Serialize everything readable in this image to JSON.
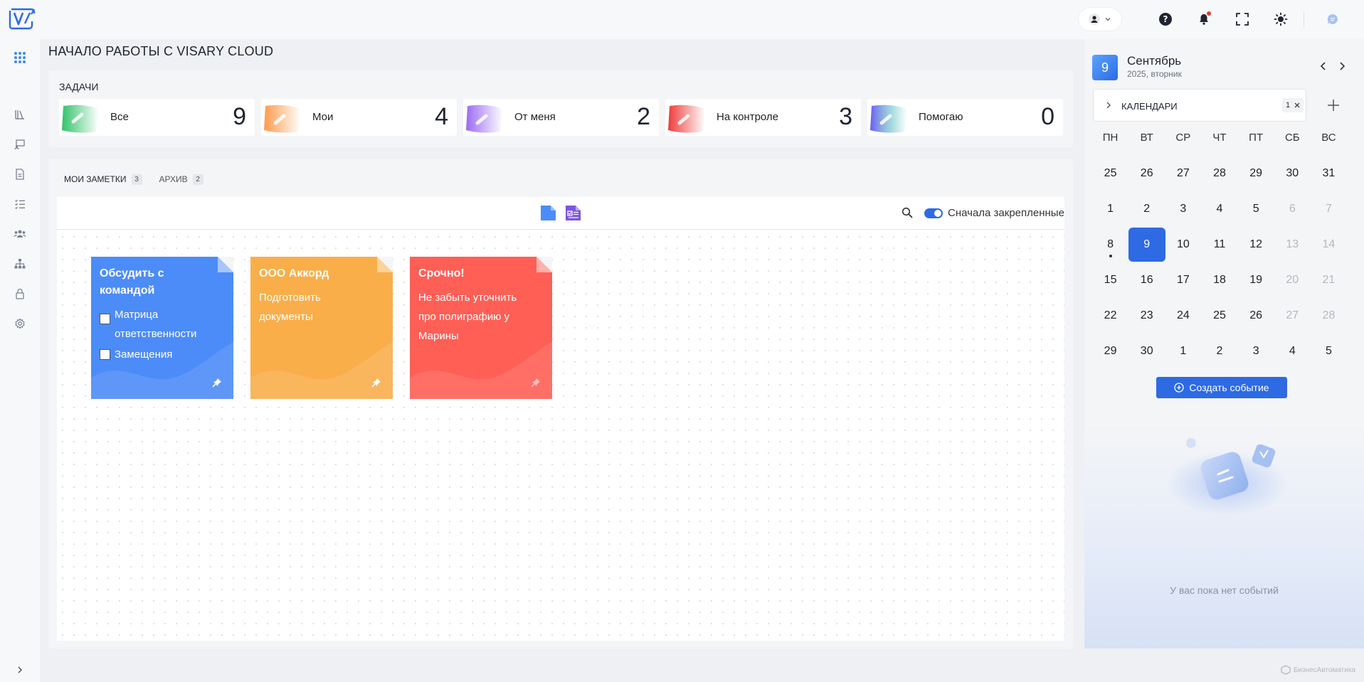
{
  "page": {
    "title": "НАЧАЛО РАБОТЫ С VISARY CLOUD"
  },
  "tasks": {
    "title": "ЗАДАЧИ",
    "items": [
      {
        "label": "Все",
        "count": "9",
        "color": "#34c26b"
      },
      {
        "label": "Мои",
        "count": "4",
        "color": "#ff9a4d"
      },
      {
        "label": "От меня",
        "count": "2",
        "color": "#9b6bf2"
      },
      {
        "label": "На контроле",
        "count": "3",
        "color": "#ef3b3b"
      },
      {
        "label": "Помогаю",
        "count": "0",
        "color": "#6a5cf0"
      }
    ]
  },
  "notes": {
    "tabs": [
      {
        "label": "МОИ ЗАМЕТКИ",
        "count": "3"
      },
      {
        "label": "АРХИВ",
        "count": "2"
      }
    ],
    "toolbar": {
      "pinned_first_label": "Сначала закрепленные"
    },
    "items": [
      {
        "title": "Обсудить с командой",
        "checklist": [
          "Матрица ответственности",
          "Замещения"
        ],
        "color": "#4c8cf8"
      },
      {
        "title": "ООО Аккорд",
        "body": "Подготовить документы",
        "color": "#f9ae4a"
      },
      {
        "title": "Срочно!",
        "body": "Не забыть уточнить про полиграфию у Марины",
        "color": "#ff5f55"
      }
    ]
  },
  "calendar": {
    "day": "9",
    "month": "Сентябрь",
    "sub": "2025, вторник",
    "select_label": "КАЛЕНДАРИ",
    "select_count": "1",
    "weekdays": [
      "ПН",
      "ВТ",
      "СР",
      "ЧТ",
      "ПТ",
      "СБ",
      "ВС"
    ],
    "weeks": [
      [
        [
          "25",
          "n"
        ],
        [
          "26",
          "n"
        ],
        [
          "27",
          "n"
        ],
        [
          "28",
          "n"
        ],
        [
          "29",
          "n"
        ],
        [
          "30",
          "n"
        ],
        [
          "31",
          "n"
        ]
      ],
      [
        [
          "1",
          "n"
        ],
        [
          "2",
          "n"
        ],
        [
          "3",
          "n"
        ],
        [
          "4",
          "n"
        ],
        [
          "5",
          "n"
        ],
        [
          "6",
          "m"
        ],
        [
          "7",
          "m"
        ]
      ],
      [
        [
          "8",
          "e"
        ],
        [
          "9",
          "t"
        ],
        [
          "10",
          "n"
        ],
        [
          "11",
          "n"
        ],
        [
          "12",
          "n"
        ],
        [
          "13",
          "m"
        ],
        [
          "14",
          "m"
        ]
      ],
      [
        [
          "15",
          "n"
        ],
        [
          "16",
          "n"
        ],
        [
          "17",
          "n"
        ],
        [
          "18",
          "n"
        ],
        [
          "19",
          "n"
        ],
        [
          "20",
          "m"
        ],
        [
          "21",
          "m"
        ]
      ],
      [
        [
          "22",
          "n"
        ],
        [
          "23",
          "n"
        ],
        [
          "24",
          "n"
        ],
        [
          "25",
          "n"
        ],
        [
          "26",
          "n"
        ],
        [
          "27",
          "m"
        ],
        [
          "28",
          "m"
        ]
      ],
      [
        [
          "29",
          "n"
        ],
        [
          "30",
          "n"
        ],
        [
          "1",
          "n"
        ],
        [
          "2",
          "n"
        ],
        [
          "3",
          "n"
        ],
        [
          "4",
          "n"
        ],
        [
          "5",
          "n"
        ]
      ]
    ],
    "create_label": "Создать событие",
    "empty_text": "У вас пока нет событий"
  },
  "watermark": "БизнесАвтоматика",
  "colors": {
    "accent": "#2d6ae3",
    "logo": "#2d6ae3"
  }
}
